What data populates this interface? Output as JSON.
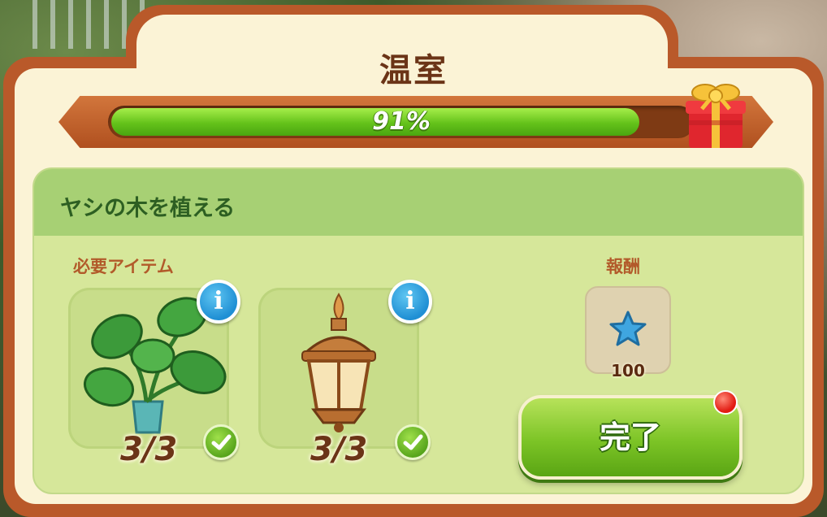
{
  "window": {
    "title": "温室"
  },
  "progress": {
    "value": 0.91,
    "label": "91%"
  },
  "reward_gift": {
    "icon": "gift-box-icon"
  },
  "task": {
    "title": "ヤシの木を植える",
    "required_label": "必要アイテム",
    "reward_label": "報酬",
    "items": [
      {
        "name": "monstera-plant",
        "icon": "potted-plant-icon",
        "count": "3/3",
        "complete": true
      },
      {
        "name": "lantern",
        "icon": "lantern-icon",
        "count": "3/3",
        "complete": true
      }
    ],
    "reward": {
      "icon": "blue-star-icon",
      "amount": "100"
    }
  },
  "actions": {
    "complete_label": "完了"
  },
  "colors": {
    "frame": "#b9592a",
    "panel": "#d6e79a",
    "progress_fill": "#64c21a",
    "title_text": "#6b3417"
  }
}
